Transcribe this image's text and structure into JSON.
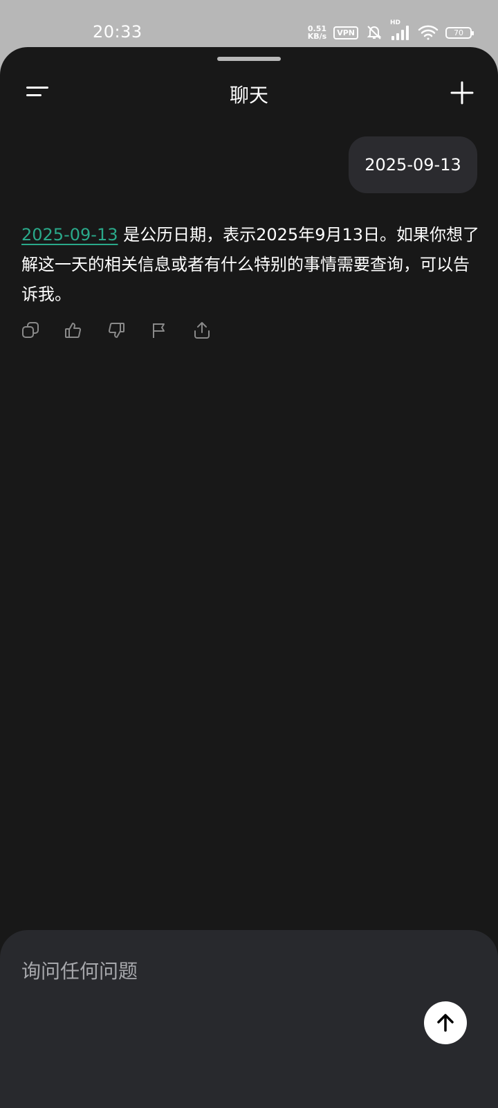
{
  "status_bar": {
    "time": "20:33",
    "net_speed_value": "0.51",
    "net_speed_unit": "KB/s",
    "vpn": "VPN",
    "signal_label": "HD",
    "battery": "70",
    "icons": [
      "mute-bell-icon",
      "signal-icon",
      "wifi-icon",
      "battery-icon"
    ]
  },
  "header": {
    "title": "聊天",
    "menu_icon": "menu-icon",
    "new_chat_icon": "plus-icon"
  },
  "conversation": {
    "user_message": "2025-09-13",
    "assistant_reply": {
      "link_text": "2025-09-13",
      "text": " 是公历日期，表示2025年9月13日。如果你想了解这一天的相关信息或者有什么特别的事情需要查询，可以告诉我。"
    },
    "actions": [
      "copy-icon",
      "thumbs-up-icon",
      "thumbs-down-icon",
      "flag-icon",
      "share-icon"
    ]
  },
  "composer": {
    "placeholder": "询问任何问题",
    "send_icon": "arrow-up-icon"
  },
  "colors": {
    "background": "#181818",
    "bubble": "#2b2b2f",
    "composer": "#28292d",
    "link": "#2aa98a",
    "status_bar": "#b7b7b7"
  }
}
